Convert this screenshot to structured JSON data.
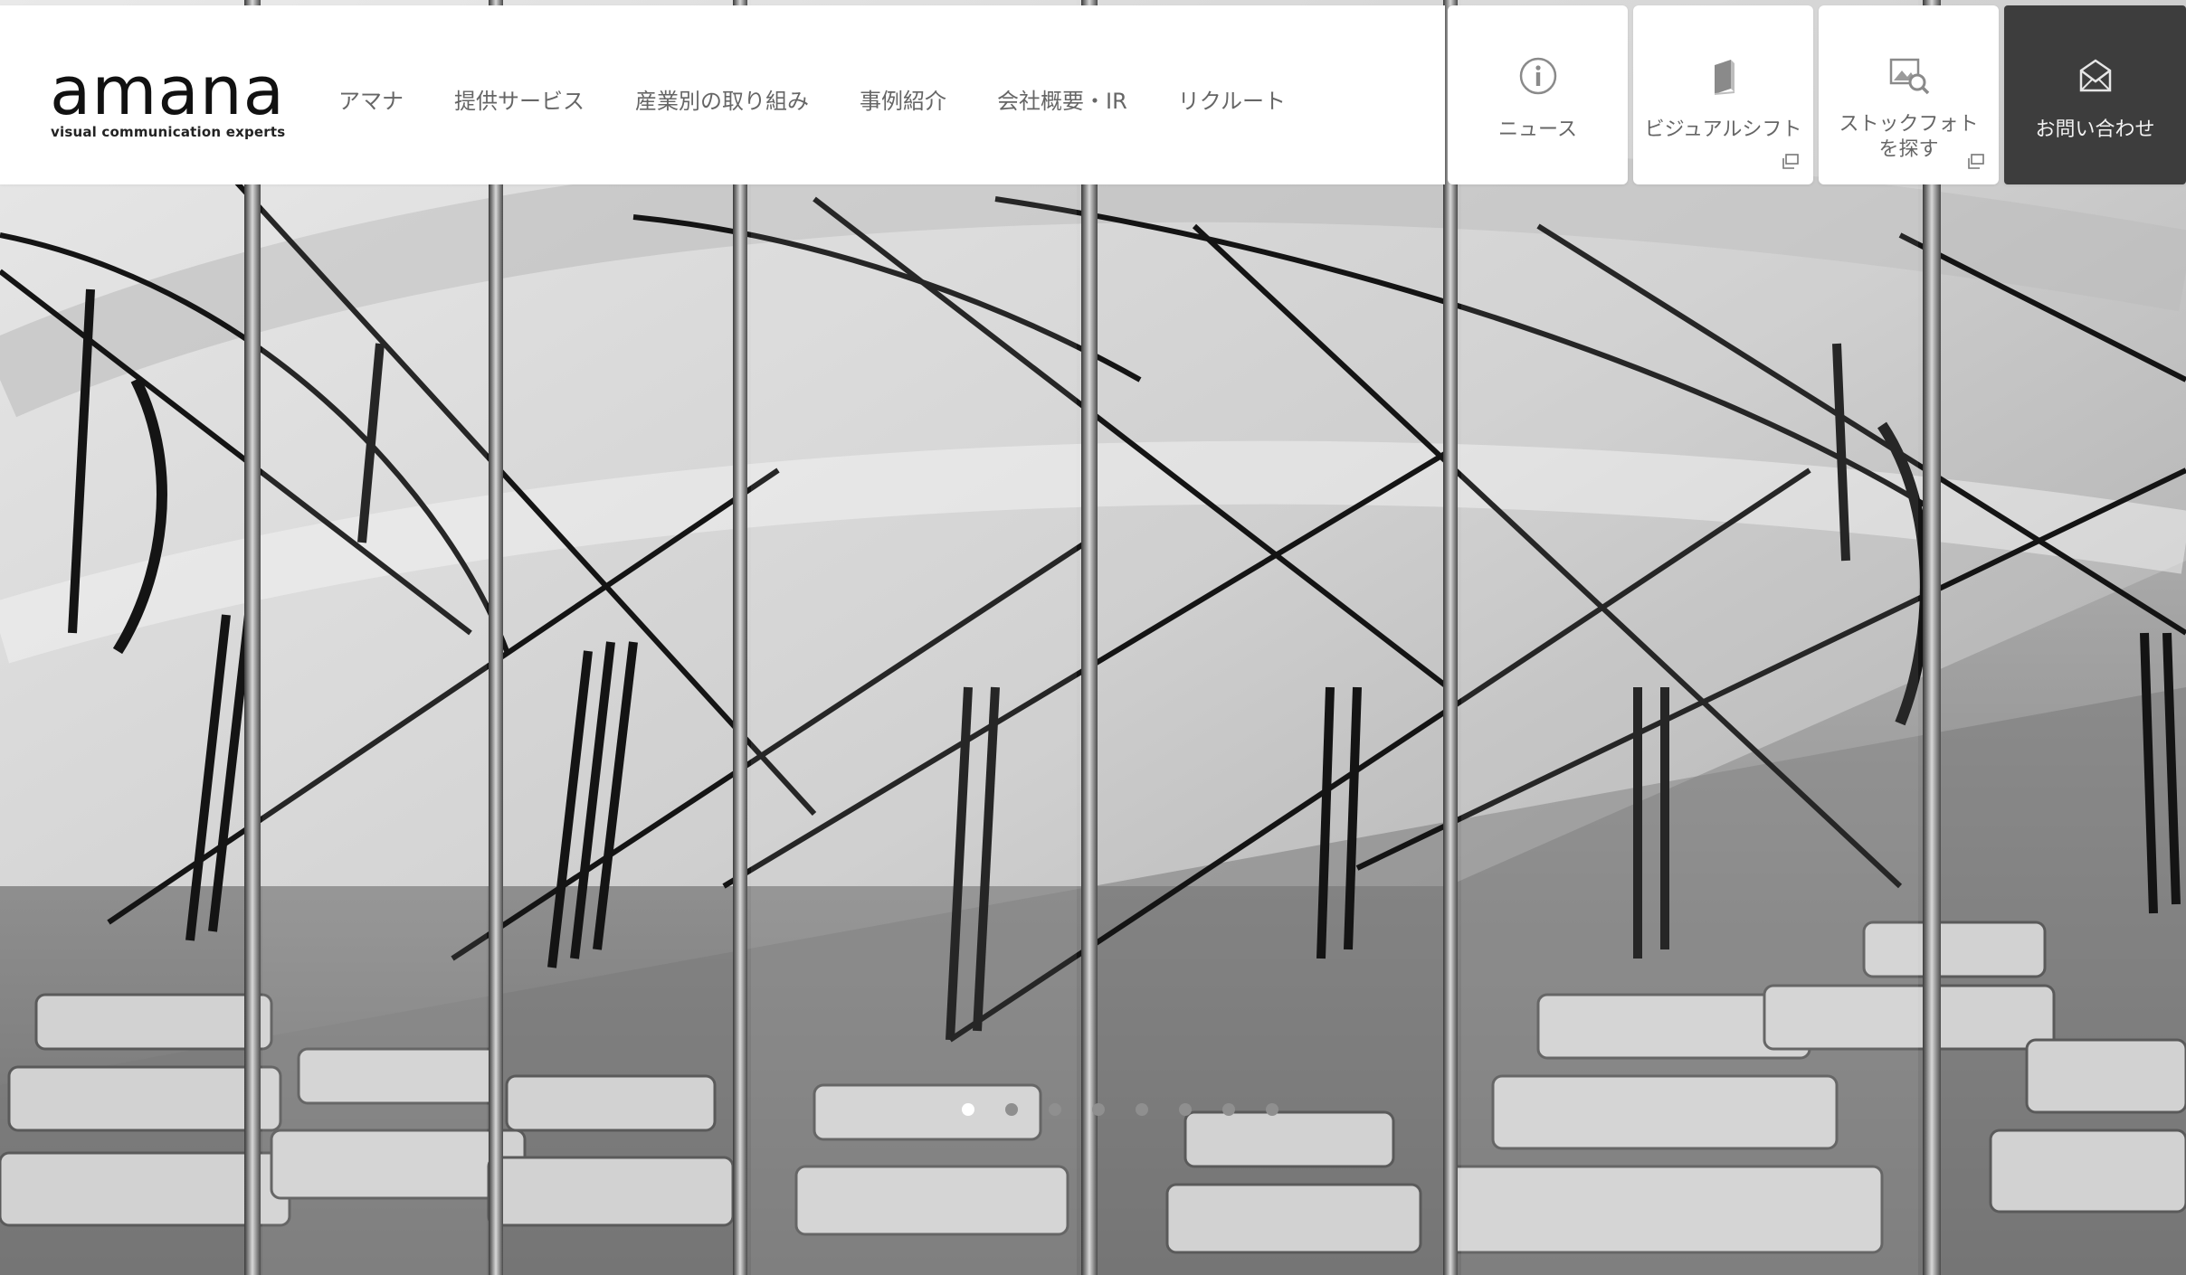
{
  "logo": {
    "wordmark": "amana",
    "tagline": "visual communication experts"
  },
  "nav": {
    "items": [
      {
        "label": "アマナ"
      },
      {
        "label": "提供サービス"
      },
      {
        "label": "産業別の取り組み"
      },
      {
        "label": "事例紹介"
      },
      {
        "label": "会社概要・IR"
      },
      {
        "label": "リクルート"
      }
    ]
  },
  "utility": {
    "news": {
      "label": "ニュース",
      "icon": "info-icon"
    },
    "visual_shift": {
      "label": "ビジュアルシフト",
      "icon": "book-icon",
      "external": true
    },
    "stock_photo": {
      "label_line1": "ストックフォト",
      "label_line2": "を探す",
      "icon": "image-search-icon",
      "external": true
    },
    "contact": {
      "label": "お問い合わせ",
      "icon": "envelope-icon"
    }
  },
  "hero": {
    "image": "black-and-white spiral staircase seen through vertical mirror panels",
    "slides_total": 8,
    "active_slide": 1
  },
  "colors": {
    "header_bg": "#ffffff",
    "nav_text": "#666666",
    "contact_bg": "#3d3d3d",
    "dot_active": "#ffffff",
    "dot_inactive": "#8f8f8f"
  }
}
